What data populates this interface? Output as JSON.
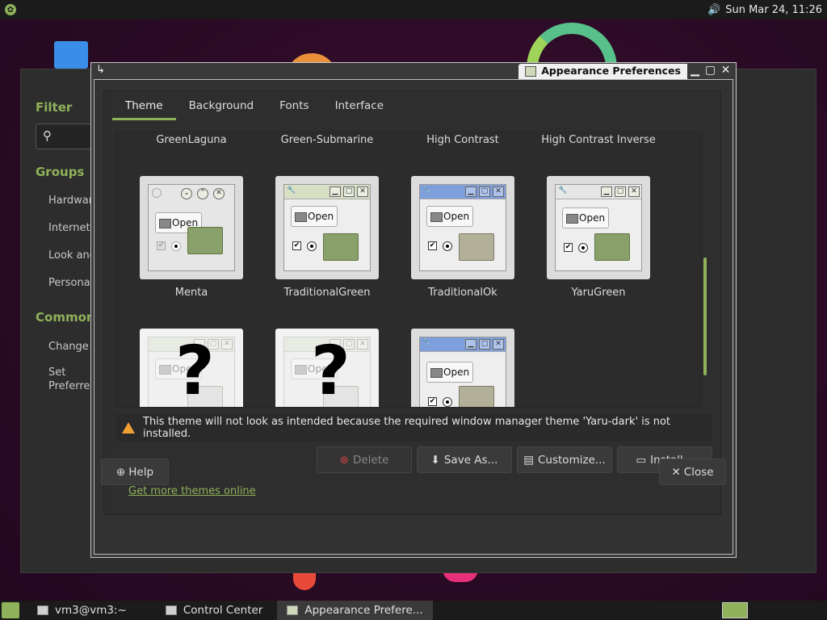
{
  "topbar": {
    "clock": "Sun Mar 24, 11:26",
    "volume_icon": "volume-icon"
  },
  "control_center": {
    "filter_heading": "Filter",
    "groups_heading": "Groups",
    "groups": [
      "Hardware",
      "Internet and Network",
      "Look and Feel",
      "Personal"
    ],
    "common_heading": "Common Tasks",
    "tasks": [
      "Change Theme",
      "Set Preferred Applications"
    ]
  },
  "dialog": {
    "title": "Appearance Preferences",
    "tabs": [
      "Theme",
      "Background",
      "Fonts",
      "Interface"
    ],
    "active_tab": "Theme",
    "theme_row_top_labels": [
      "GreenLaguna",
      "Green-Submarine",
      "High Contrast",
      "High Contrast Inverse"
    ],
    "theme_row_mid": [
      {
        "name": "Menta",
        "open_label": "Open"
      },
      {
        "name": "TraditionalGreen",
        "open_label": "Open"
      },
      {
        "name": "TraditionalOk",
        "open_label": "Open"
      },
      {
        "name": "YaruGreen",
        "open_label": "Open"
      }
    ],
    "theme_row_bottom": [
      {
        "open_label": "Open",
        "missing_mark": "?"
      },
      {
        "open_label": "Open",
        "missing_mark": "?"
      },
      {
        "open_label": "Open"
      }
    ],
    "warning": "This theme will not look as intended because the required window manager theme 'Yaru-dark' is not installed.",
    "buttons": {
      "delete": "Delete",
      "save_as": "Save As...",
      "customize": "Customize...",
      "install": "Install..."
    },
    "more_themes_link": "Get more themes online",
    "help": "Help",
    "close": "Close"
  },
  "taskbar": {
    "tasks": [
      "vm3@vm3:~",
      "Control Center",
      "Appearance Prefere..."
    ]
  },
  "colors": {
    "accent": "#8fb25a",
    "warning": "#f0a030"
  }
}
